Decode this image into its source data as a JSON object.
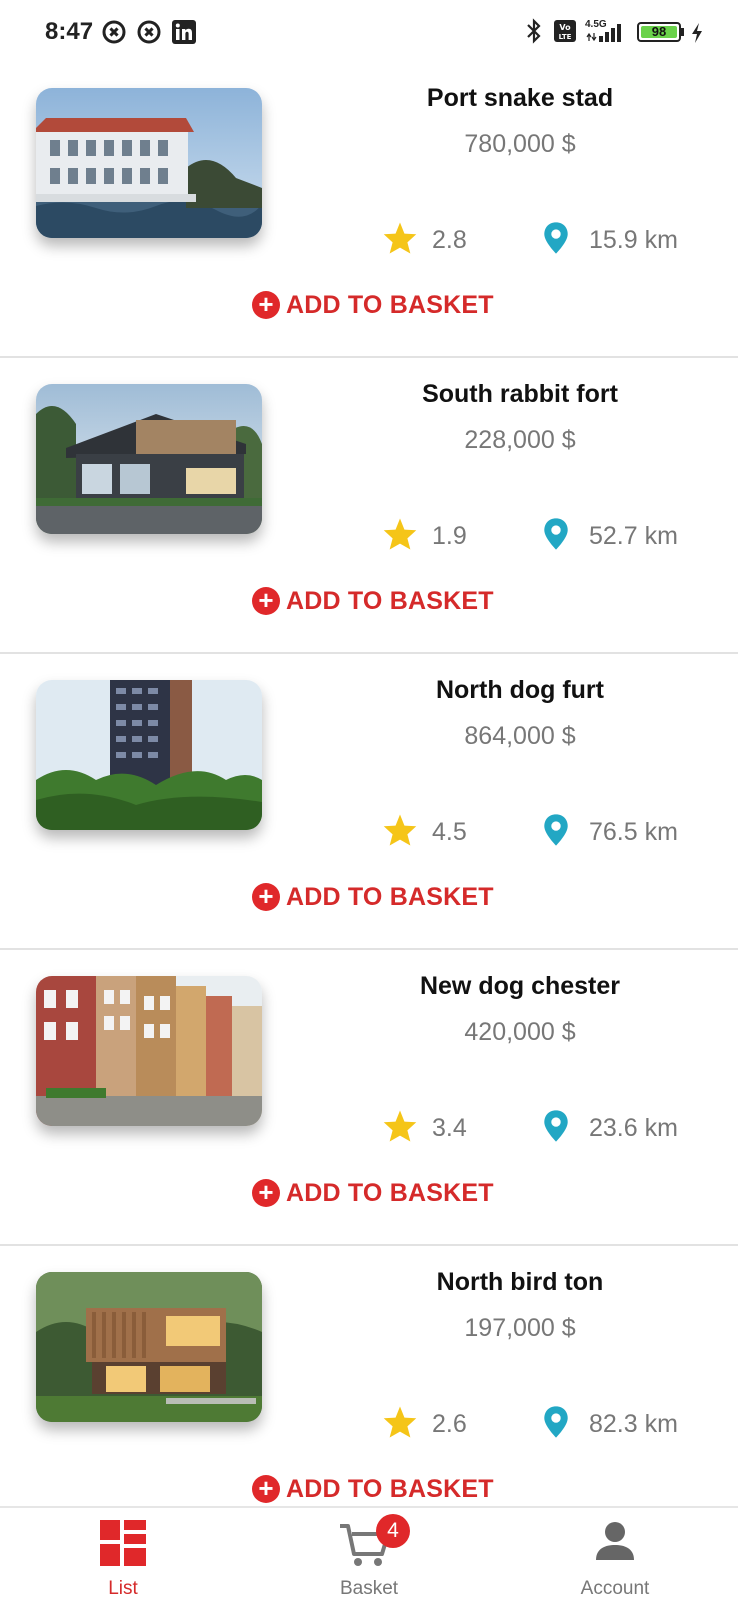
{
  "status_bar": {
    "time": "8:47",
    "battery": "98",
    "network": "4.5G"
  },
  "items": [
    {
      "title": "Port snake stad",
      "price": "780,000 $",
      "rating": "2.8",
      "distance": "15.9 km",
      "action": "ADD TO BASKET"
    },
    {
      "title": "South rabbit fort",
      "price": "228,000 $",
      "rating": "1.9",
      "distance": "52.7 km",
      "action": "ADD TO BASKET"
    },
    {
      "title": "North dog furt",
      "price": "864,000 $",
      "rating": "4.5",
      "distance": "76.5 km",
      "action": "ADD TO BASKET"
    },
    {
      "title": "New dog chester",
      "price": "420,000 $",
      "rating": "3.4",
      "distance": "23.6 km",
      "action": "ADD TO BASKET"
    },
    {
      "title": "North bird ton",
      "price": "197,000 $",
      "rating": "2.6",
      "distance": "82.3 km",
      "action": "ADD TO BASKET"
    }
  ],
  "bottom_nav": {
    "list_label": "List",
    "basket_label": "Basket",
    "basket_count": "4",
    "account_label": "Account"
  },
  "colors": {
    "accent": "#d52a2a",
    "star": "#f5c518",
    "pin": "#22a7c4",
    "battery": "#6ad24a"
  },
  "icons": {
    "rating": "star-icon",
    "distance": "location-pin-icon",
    "add": "plus-circle-icon",
    "list": "grid-list-icon",
    "basket": "cart-icon",
    "account": "person-icon"
  }
}
